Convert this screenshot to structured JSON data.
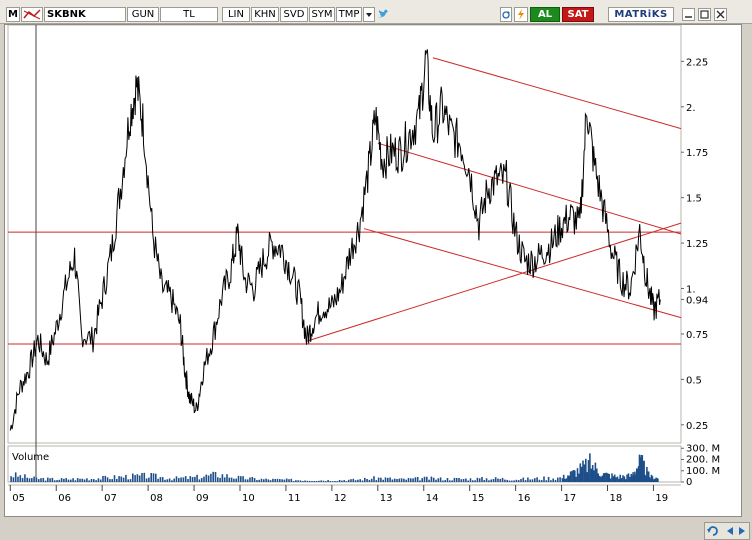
{
  "toolbar": {
    "m_label": "M",
    "symbol": "SKBNK",
    "period": "GUN",
    "currency": "TL",
    "scale_lin": "LIN",
    "khn": "KHN",
    "svd": "SVD",
    "sym": "SYM",
    "tmp": "TMP",
    "buy_label": "AL",
    "sell_label": "SAT",
    "brand": "MATRiKS",
    "icons": [
      "grid-icon",
      "dropdown-arrow-icon",
      "twitter-bird-icon",
      "refresh-icon",
      "lightning-icon",
      "minimize-icon",
      "maximize-icon",
      "close-icon"
    ]
  },
  "volume": {
    "label": "Volume",
    "axis_labels": [
      "300. M",
      "200. M",
      "100. M",
      "0"
    ]
  },
  "colors": {
    "price_line": "#000000",
    "trend_lines": "#cc2a2a",
    "volume_bars": "#1f4f8a",
    "frame_bg": "#ffffff",
    "al": "#1c8a1c",
    "sat": "#c41818"
  },
  "chart_data": {
    "type": "line",
    "symbol": "SKBNK",
    "price_axis_ticks": [
      "2.25",
      "2.",
      "1.75",
      "1.5",
      "1.25",
      "1.",
      "0.94",
      "0.75",
      "0.5",
      "0.25"
    ],
    "last_price": 0.94,
    "x_tick_labels": [
      "05",
      "06",
      "07",
      "08",
      "09",
      "10",
      "11",
      "12",
      "13",
      "14",
      "15",
      "16",
      "17",
      "18",
      "19"
    ],
    "ylim": [
      0.15,
      2.45
    ],
    "series": [
      {
        "values": [
          [
            5.0,
            0.22
          ],
          [
            5.2,
            0.45
          ],
          [
            5.4,
            0.55
          ],
          [
            5.6,
            0.72
          ],
          [
            5.8,
            0.6
          ],
          [
            6.0,
            0.78
          ],
          [
            6.2,
            1.0
          ],
          [
            6.4,
            1.18
          ],
          [
            6.55,
            0.75
          ],
          [
            6.8,
            0.72
          ],
          [
            7.0,
            0.95
          ],
          [
            7.2,
            1.2
          ],
          [
            7.4,
            1.55
          ],
          [
            7.6,
            1.95
          ],
          [
            7.75,
            2.12
          ],
          [
            7.9,
            1.9
          ],
          [
            8.1,
            1.3
          ],
          [
            8.3,
            1.0
          ],
          [
            8.5,
            0.95
          ],
          [
            8.7,
            0.8
          ],
          [
            8.8,
            0.55
          ],
          [
            8.9,
            0.4
          ],
          [
            9.05,
            0.33
          ],
          [
            9.2,
            0.55
          ],
          [
            9.4,
            0.72
          ],
          [
            9.6,
            0.95
          ],
          [
            9.8,
            1.1
          ],
          [
            9.95,
            1.3
          ],
          [
            10.1,
            1.05
          ],
          [
            10.3,
            1.0
          ],
          [
            10.5,
            1.15
          ],
          [
            10.7,
            1.25
          ],
          [
            10.9,
            1.22
          ],
          [
            11.1,
            1.1
          ],
          [
            11.3,
            0.95
          ],
          [
            11.45,
            0.72
          ],
          [
            11.6,
            0.82
          ],
          [
            11.8,
            0.9
          ],
          [
            12.0,
            0.9
          ],
          [
            12.2,
            1.0
          ],
          [
            12.4,
            1.2
          ],
          [
            12.6,
            1.35
          ],
          [
            12.8,
            1.65
          ],
          [
            12.95,
            1.95
          ],
          [
            13.1,
            1.7
          ],
          [
            13.3,
            1.75
          ],
          [
            13.5,
            1.75
          ],
          [
            13.7,
            1.85
          ],
          [
            13.9,
            1.95
          ],
          [
            14.05,
            2.27
          ],
          [
            14.2,
            1.85
          ],
          [
            14.4,
            2.0
          ],
          [
            14.6,
            1.85
          ],
          [
            14.8,
            1.8
          ],
          [
            15.0,
            1.65
          ],
          [
            15.2,
            1.35
          ],
          [
            15.4,
            1.55
          ],
          [
            15.6,
            1.6
          ],
          [
            15.8,
            1.6
          ],
          [
            16.0,
            1.3
          ],
          [
            16.2,
            1.15
          ],
          [
            16.4,
            1.15
          ],
          [
            16.6,
            1.2
          ],
          [
            16.8,
            1.25
          ],
          [
            17.0,
            1.35
          ],
          [
            17.2,
            1.4
          ],
          [
            17.4,
            1.35
          ],
          [
            17.55,
            2.0
          ],
          [
            17.7,
            1.7
          ],
          [
            17.9,
            1.45
          ],
          [
            18.1,
            1.2
          ],
          [
            18.3,
            1.05
          ],
          [
            18.5,
            1.0
          ],
          [
            18.7,
            1.32
          ],
          [
            18.85,
            1.05
          ],
          [
            19.0,
            0.88
          ],
          [
            19.15,
            0.94
          ]
        ]
      }
    ],
    "volume_series_millions": [
      [
        5.0,
        80
      ],
      [
        5.5,
        40
      ],
      [
        6.0,
        30
      ],
      [
        6.5,
        35
      ],
      [
        7.0,
        45
      ],
      [
        7.5,
        60
      ],
      [
        8.0,
        70
      ],
      [
        8.5,
        40
      ],
      [
        9.0,
        50
      ],
      [
        9.5,
        85
      ],
      [
        10.0,
        45
      ],
      [
        10.5,
        30
      ],
      [
        11.0,
        25
      ],
      [
        11.5,
        20
      ],
      [
        12.0,
        20
      ],
      [
        12.5,
        25
      ],
      [
        13.0,
        45
      ],
      [
        13.5,
        30
      ],
      [
        14.0,
        40
      ],
      [
        14.5,
        35
      ],
      [
        15.0,
        35
      ],
      [
        15.5,
        40
      ],
      [
        16.0,
        30
      ],
      [
        16.5,
        40
      ],
      [
        17.0,
        50
      ],
      [
        17.3,
        120
      ],
      [
        17.6,
        210
      ],
      [
        17.9,
        90
      ],
      [
        18.2,
        60
      ],
      [
        18.5,
        70
      ],
      [
        18.7,
        230
      ],
      [
        18.9,
        60
      ],
      [
        19.1,
        40
      ]
    ],
    "trend_lines": [
      {
        "kind": "horizontal",
        "y": 1.31
      },
      {
        "kind": "horizontal",
        "y": 0.695
      },
      {
        "kind": "channel-upper",
        "from": [
          14.2,
          2.27
        ],
        "to": [
          19.6,
          1.88
        ]
      },
      {
        "kind": "channel-lower",
        "from": [
          13.0,
          1.8
        ],
        "to": [
          19.6,
          1.3
        ]
      },
      {
        "kind": "channel-bottom",
        "from": [
          12.7,
          1.33
        ],
        "to": [
          19.6,
          0.84
        ]
      },
      {
        "kind": "rising",
        "from": [
          11.45,
          0.71
        ],
        "to": [
          19.6,
          1.36
        ]
      }
    ]
  }
}
